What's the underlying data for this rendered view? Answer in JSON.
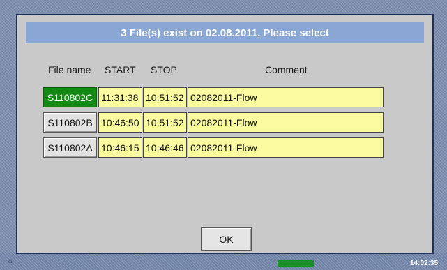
{
  "colors": {
    "title_bar": "#8aa6d2",
    "dialog_bg": "#c9c9c9",
    "cell_bg": "#fafaa0",
    "selected_button": "#148a14"
  },
  "dialog": {
    "title": "3 File(s) exist on 02.08.2011, Please select",
    "headers": {
      "file_name": "File name",
      "start": "START",
      "stop": "STOP",
      "comment": "Comment"
    },
    "rows": [
      {
        "file": "S110802C",
        "start": "11:31:38",
        "stop": "10:51:52",
        "comment": "02082011-Flow",
        "selected": true
      },
      {
        "file": "S110802B",
        "start": "10:46:50",
        "stop": "10:51:52",
        "comment": "02082011-Flow",
        "selected": false
      },
      {
        "file": "S110802A",
        "start": "10:46:15",
        "stop": "10:46:46",
        "comment": "02082011-Flow",
        "selected": false
      }
    ],
    "ok_label": "OK"
  },
  "background": {
    "bottom_time": "14:02:35"
  }
}
